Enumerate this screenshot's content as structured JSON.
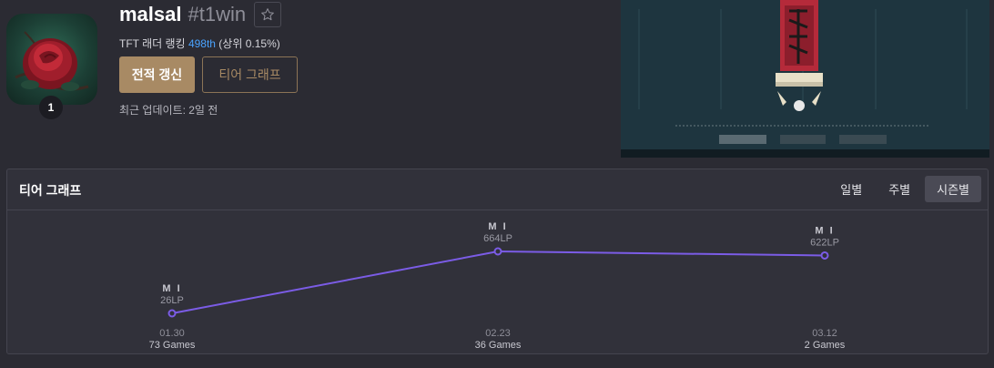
{
  "profile": {
    "name": "malsal",
    "tag": "#t1win",
    "rank_prefix": "TFT 래더 랭킹 ",
    "rank_number": "498th",
    "rank_suffix": " (상위 0.15%)",
    "level": "1",
    "updated": "최근 업데이트: 2일 전"
  },
  "buttons": {
    "refresh": "전적 갱신",
    "tier_graph": "티어 그래프"
  },
  "panel": {
    "title": "티어 그래프",
    "tabs": [
      {
        "label": "일별",
        "active": false
      },
      {
        "label": "주별",
        "active": false
      },
      {
        "label": "시즌별",
        "active": true
      }
    ]
  },
  "chart_data": {
    "type": "line",
    "points": [
      {
        "x": "01.30",
        "games": "73 Games",
        "tier": "M I",
        "lp_label": "26LP",
        "lp": 26
      },
      {
        "x": "02.23",
        "games": "36 Games",
        "tier": "M I",
        "lp_label": "664LP",
        "lp": 664
      },
      {
        "x": "03.12",
        "games": "2 Games",
        "tier": "M I",
        "lp_label": "622LP",
        "lp": 622
      }
    ],
    "line_color": "#7b5ce6"
  },
  "colors": {
    "accent_gold": "#a88a64",
    "rank_link": "#4aa3ff",
    "line": "#7b5ce6"
  },
  "icons": {
    "favorite": "star-outline-icon"
  }
}
